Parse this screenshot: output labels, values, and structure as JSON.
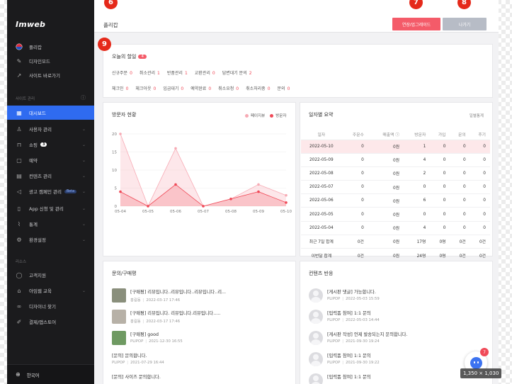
{
  "app": {
    "logo": "Imweb"
  },
  "markers": {
    "m6": "6",
    "m7": "7",
    "m8": "8",
    "m9": "9"
  },
  "sidebar": {
    "top_items": [
      {
        "label": "플리캅",
        "icon": "flag-icon"
      },
      {
        "label": "디자인모드",
        "icon": "brush-icon"
      },
      {
        "label": "사이트 바로가기",
        "icon": "external-link-icon"
      }
    ],
    "section_site": "사이트 관리",
    "items": [
      {
        "label": "대시보드",
        "icon": "dashboard-icon",
        "active": true
      },
      {
        "label": "사용자 관리",
        "icon": "user-icon"
      },
      {
        "label": "쇼핑",
        "icon": "bag-icon",
        "badge": "3"
      },
      {
        "label": "예약",
        "icon": "calendar-icon"
      },
      {
        "label": "컨텐츠 관리",
        "icon": "content-icon"
      },
      {
        "label": "광고 캠페인 관리",
        "icon": "megaphone-icon",
        "badge": "Beta"
      },
      {
        "label": "App 신청 및 관리",
        "icon": "mobile-icon"
      },
      {
        "label": "통계",
        "icon": "chart-icon"
      },
      {
        "label": "환경설정",
        "icon": "gear-icon"
      }
    ],
    "section_resources": "리소스",
    "resource_items": [
      {
        "label": "고객지원",
        "icon": "chat-icon"
      },
      {
        "label": "아임웹 교육",
        "icon": "education-icon"
      },
      {
        "label": "디자이너 찾기",
        "icon": "glasses-icon"
      },
      {
        "label": "결제/앱스토어",
        "icon": "pen-icon"
      }
    ],
    "language": "한국어"
  },
  "topbar": {
    "title": "플리캅",
    "upgrade_button": "연장/업그레이드",
    "exit_button": "나가기"
  },
  "today": {
    "title": "오늘의 할일",
    "count": "4",
    "row1": [
      {
        "label": "신규주문",
        "value": "0",
        "highlight": true
      },
      {
        "label": "취소관리",
        "value": "1",
        "highlight": true
      },
      {
        "label": "반품관리",
        "value": "1",
        "highlight": true
      },
      {
        "label": "교환관리",
        "value": "0",
        "highlight": true
      },
      {
        "label": "답변대기 문의",
        "value": "2",
        "highlight": true
      }
    ],
    "row2": [
      {
        "label": "체크인",
        "value": "0",
        "highlight": true
      },
      {
        "label": "체크아웃",
        "value": "0",
        "highlight": true
      },
      {
        "label": "입금대기",
        "value": "0",
        "highlight": true
      },
      {
        "label": "예약완료",
        "value": "0",
        "highlight": true
      },
      {
        "label": "취소요청",
        "value": "0",
        "highlight": true
      },
      {
        "label": "취소처리중",
        "value": "0",
        "highlight": true
      },
      {
        "label": "문의",
        "value": "0",
        "highlight": true
      }
    ]
  },
  "visitors": {
    "title": "방문자 현황",
    "legend": [
      "페이지뷰",
      "방문자"
    ]
  },
  "chart_data": {
    "type": "area",
    "title": "방문자 현황",
    "categories": [
      "05-04",
      "05-05",
      "05-06",
      "05-07",
      "05-08",
      "05-09",
      "05-10"
    ],
    "series": [
      {
        "name": "페이지뷰",
        "values": [
          20,
          0,
          16,
          0,
          2,
          6,
          3
        ],
        "color": "#f7aab4"
      },
      {
        "name": "방문자",
        "values": [
          4,
          0,
          6,
          0,
          2,
          4,
          1
        ],
        "color": "#f04a58"
      }
    ],
    "yticks": [
      "0",
      "5",
      "10",
      "15",
      "20"
    ],
    "ylim": [
      0,
      20
    ],
    "grid": true,
    "legend": "top-right"
  },
  "daily": {
    "title": "일자별 요약",
    "more": "일별통계",
    "headers": [
      "일자",
      "주문수",
      "매출액 ⓘ",
      "방문자",
      "가입",
      "문의",
      "후기"
    ],
    "rows": [
      [
        "2022-05-10",
        "0",
        "0원",
        "1",
        "0",
        "0",
        "0"
      ],
      [
        "2022-05-09",
        "0",
        "0원",
        "4",
        "0",
        "0",
        "0"
      ],
      [
        "2022-05-08",
        "0",
        "0원",
        "2",
        "0",
        "0",
        "0"
      ],
      [
        "2022-05-07",
        "0",
        "0원",
        "0",
        "0",
        "0",
        "0"
      ],
      [
        "2022-05-06",
        "0",
        "0원",
        "6",
        "0",
        "0",
        "0"
      ],
      [
        "2022-05-05",
        "0",
        "0원",
        "0",
        "0",
        "0",
        "0"
      ],
      [
        "2022-05-04",
        "0",
        "0원",
        "4",
        "0",
        "0",
        "0"
      ],
      [
        "최근 7일 합계",
        "0건",
        "0원",
        "17명",
        "0명",
        "0건",
        "0건"
      ],
      [
        "이번달 합계",
        "0건",
        "0원",
        "24명",
        "0명",
        "0건",
        "0건"
      ]
    ]
  },
  "inquiries": {
    "title": "문의/구매평",
    "items": [
      {
        "title": "[구매평] 리뷰입니다..리뷰입니다..리뷰입니다..리...",
        "author": "홍길동",
        "date": "2022-03-17 17:46",
        "thumb": "#8a8f7c"
      },
      {
        "title": "[구매평] 리뷰입니다. 리뷰입니다.리뷰입니다.....",
        "author": "홍길동",
        "date": "2022-03-17 17:46",
        "thumb": "#b7b1a7"
      },
      {
        "title": "[구매평] good",
        "author": "PLIPOP",
        "date": "2021-12-30 16:55",
        "thumb": "#6f9a62"
      },
      {
        "title": "[문의] 문의합니다.",
        "author": "PLIPOP",
        "date": "2021-07-29 16:44",
        "thumb": ""
      },
      {
        "title": "[문의] 사이즈 문의합니다.",
        "author": "",
        "date": "",
        "thumb": ""
      }
    ]
  },
  "content_response": {
    "title": "컨텐츠 반응",
    "items": [
      {
        "title": "[게시판 댓글] 가능합니다.",
        "author": "PLIPOP",
        "date": "2022-05-03 15:59"
      },
      {
        "title": "[입력폼 참여] 1:1 문의",
        "author": "PLIPOP",
        "date": "2022-05-03 14:44"
      },
      {
        "title": "[게시판 작성] 언제 발송되는지 문의합니다.",
        "author": "PLIPOP",
        "date": "2021-09-30 19:24"
      },
      {
        "title": "[입력폼 참여] 1:1 문의",
        "author": "PLIPOP",
        "date": "2021-09-30 19:22"
      },
      {
        "title": "[입력폼 참여] 1:1 문의",
        "author": "",
        "date": ""
      }
    ]
  },
  "chat": {
    "count": "7"
  },
  "overlay": {
    "dimensions": "1,350 × 1,030"
  }
}
